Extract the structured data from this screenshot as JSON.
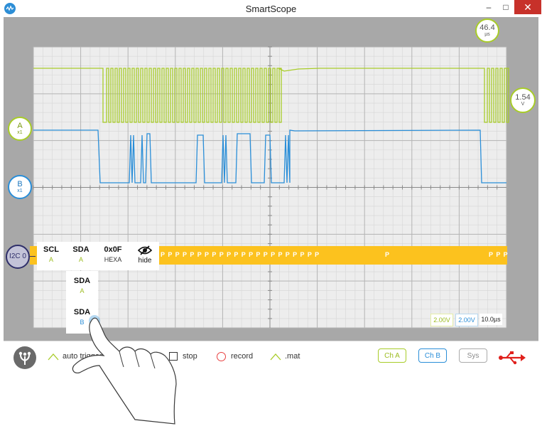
{
  "window": {
    "title": "SmartScope",
    "minimize_glyph": "–",
    "maximize_glyph": "□",
    "close_glyph": "✕"
  },
  "markers": {
    "channel_a": {
      "label": "A",
      "sub": "x1"
    },
    "channel_b": {
      "label": "B",
      "sub": "x1"
    },
    "time_offset": {
      "value": "46.4",
      "unit": "µs"
    },
    "trigger_level": {
      "value": "1.54",
      "unit": "V"
    }
  },
  "decoder": {
    "name": "I2C 0",
    "packets": [
      "P P P P P P P P P P P P P P P P P P P P P P",
      "P",
      "P P P"
    ],
    "panel": {
      "scl": {
        "label": "SCL",
        "source": "A"
      },
      "sda": {
        "label": "SDA",
        "source": "A"
      },
      "format": {
        "label": "0x0F",
        "sub": "HEXA"
      },
      "hide": {
        "label": "hide"
      }
    },
    "dropdown": [
      {
        "label": "SDA",
        "source": "A"
      },
      {
        "label": "SDA",
        "source": "B"
      }
    ]
  },
  "scale": {
    "ch_a": "2.00V",
    "ch_b": "2.00V",
    "time": "10.0µs"
  },
  "toolbar": {
    "auto_trigger": "auto trigger",
    "stop": "stop",
    "record": "record",
    "mat": ".mat",
    "ch_a": "Ch A",
    "ch_b": "Ch B",
    "sys": "Sys"
  },
  "colors": {
    "channel_a": "#a8cc28",
    "channel_b": "#2a8ed8",
    "decoder": "#fcc21e",
    "record": "#e84040",
    "usb": "#e0201c"
  }
}
